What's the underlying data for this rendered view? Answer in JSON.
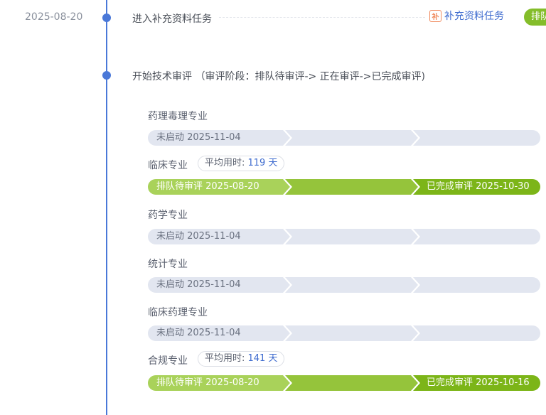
{
  "timeline": {
    "event1": {
      "date": "2025-08-20",
      "title": "进入补充资料任务",
      "link_label": "补充资料任务",
      "link_icon": "supplement-task-icon",
      "status_tag": "排队"
    },
    "event2": {
      "title": "开始技术审评 （审评阶段：排队待审评-> 正在审评->已完成审评)"
    }
  },
  "colors": {
    "timeline": "#4a78d8",
    "idle": "#e2e6f0",
    "queue_green": "#a9d25a",
    "review_green": "#95c43b",
    "done_green": "#7cb518",
    "link": "#3f6ccf"
  },
  "specialties": [
    {
      "name": "药理毒理专业",
      "status": "idle",
      "stage1": "未启动  2025-11-04"
    },
    {
      "name": "临床专业",
      "status": "done",
      "avg_label": "平均用时: ",
      "avg_value": "119 天",
      "stage1": "排队待审评  2025-08-20",
      "stage3": "已完成审评  2025-10-30"
    },
    {
      "name": "药学专业",
      "status": "idle",
      "stage1": "未启动  2025-11-04"
    },
    {
      "name": "统计专业",
      "status": "idle",
      "stage1": "未启动  2025-11-04"
    },
    {
      "name": "临床药理专业",
      "status": "idle",
      "stage1": "未启动  2025-11-04"
    },
    {
      "name": "合规专业",
      "status": "done",
      "avg_label": "平均用时: ",
      "avg_value": "141 天",
      "stage1": "排队待审评  2025-08-20",
      "stage3": "已完成审评  2025-10-16"
    }
  ]
}
